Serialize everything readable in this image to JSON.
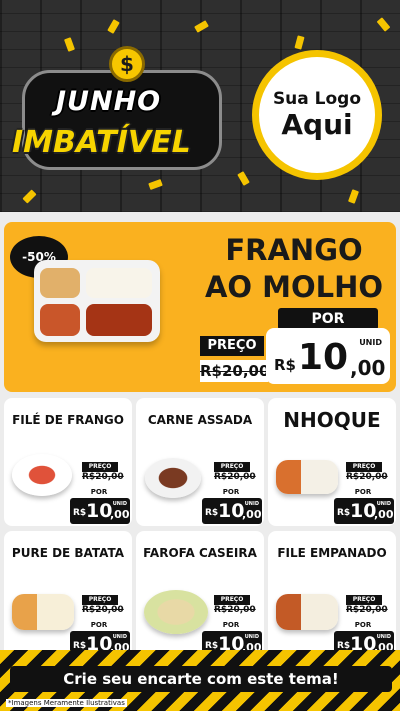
{
  "header": {
    "title_line1": "JUNHO",
    "title_line2": "IMBATÍVEL",
    "coin_symbol": "$",
    "logo_line1": "Sua Logo",
    "logo_line2": "Aqui"
  },
  "featured": {
    "discount": "-50%",
    "name_line1": "FRANGO",
    "name_line2": "AO MOLHO",
    "por_label": "POR",
    "preco_label": "PREÇO",
    "old_price": "R$20,00",
    "currency": "R$",
    "price_int": "10",
    "price_dec": ",00",
    "unit": "UNID"
  },
  "products": [
    {
      "name": "FILÉ DE FRANGO",
      "preco_label": "PREÇO",
      "old_price": "R$20,00",
      "por_label": "POR",
      "currency": "R$",
      "price_int": "10",
      "price_dec": ",00",
      "unit": "UNID"
    },
    {
      "name": "CARNE ASSADA",
      "preco_label": "PREÇO",
      "old_price": "R$20,00",
      "por_label": "POR",
      "currency": "R$",
      "price_int": "10",
      "price_dec": ",00",
      "unit": "UNID"
    },
    {
      "name": "NHOQUE",
      "preco_label": "PREÇO",
      "old_price": "R$20,00",
      "por_label": "POR",
      "currency": "R$",
      "price_int": "10",
      "price_dec": ",00",
      "unit": "UNID"
    },
    {
      "name": "PURE DE BATATA",
      "preco_label": "PREÇO",
      "old_price": "R$20,00",
      "por_label": "POR",
      "currency": "R$",
      "price_int": "10",
      "price_dec": ",00",
      "unit": "UNID"
    },
    {
      "name": "FAROFA CASEIRA",
      "preco_label": "PREÇO",
      "old_price": "R$20,00",
      "por_label": "POR",
      "currency": "R$",
      "price_int": "10",
      "price_dec": ",00",
      "unit": "UNID"
    },
    {
      "name": "FILE EMPANADO",
      "preco_label": "PREÇO",
      "old_price": "R$20,00",
      "por_label": "POR",
      "currency": "R$",
      "price_int": "10",
      "price_dec": ",00",
      "unit": "UNID"
    }
  ],
  "footer": {
    "cta": "Crie seu encarte com este tema!",
    "note": "*Imagens Meramente Ilustrativas"
  },
  "colors": {
    "accent": "#fab11f",
    "yellow": "#f5c400",
    "dark": "#111111"
  }
}
